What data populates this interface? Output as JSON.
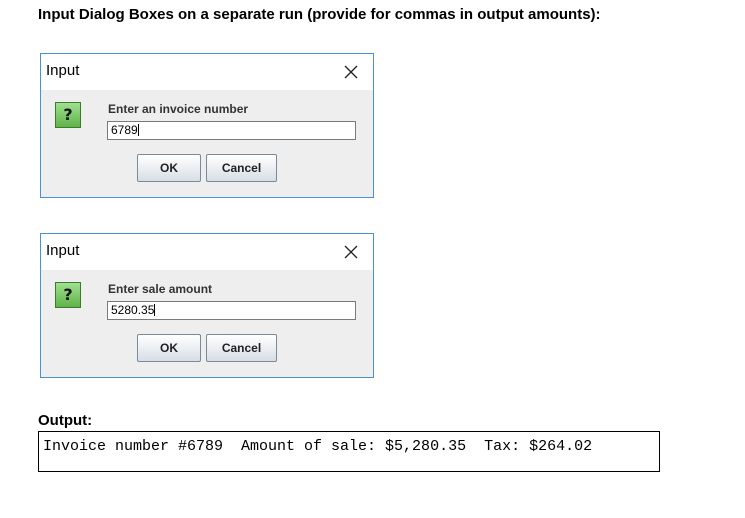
{
  "heading": "Input Dialog Boxes on a separate run (provide for commas in output amounts):",
  "dialogs": [
    {
      "title": "Input",
      "close_glyph": "✕",
      "icon_glyph": "?",
      "prompt": "Enter an invoice number",
      "value": "6789",
      "ok_label": "OK",
      "cancel_label": "Cancel"
    },
    {
      "title": "Input",
      "close_glyph": "✕",
      "icon_glyph": "?",
      "prompt": "Enter sale amount",
      "value": "5280.35",
      "ok_label": "OK",
      "cancel_label": "Cancel"
    }
  ],
  "output": {
    "label": "Output:",
    "text": "Invoice number #6789  Amount of sale: $5,280.35  Tax: $264.02"
  },
  "icons": {
    "close": "close-icon",
    "question": "question-icon"
  },
  "colors": {
    "dialog_border": "#4a90d9",
    "dialog_body": "#eeeeee",
    "question_icon": "#6fbf57"
  }
}
